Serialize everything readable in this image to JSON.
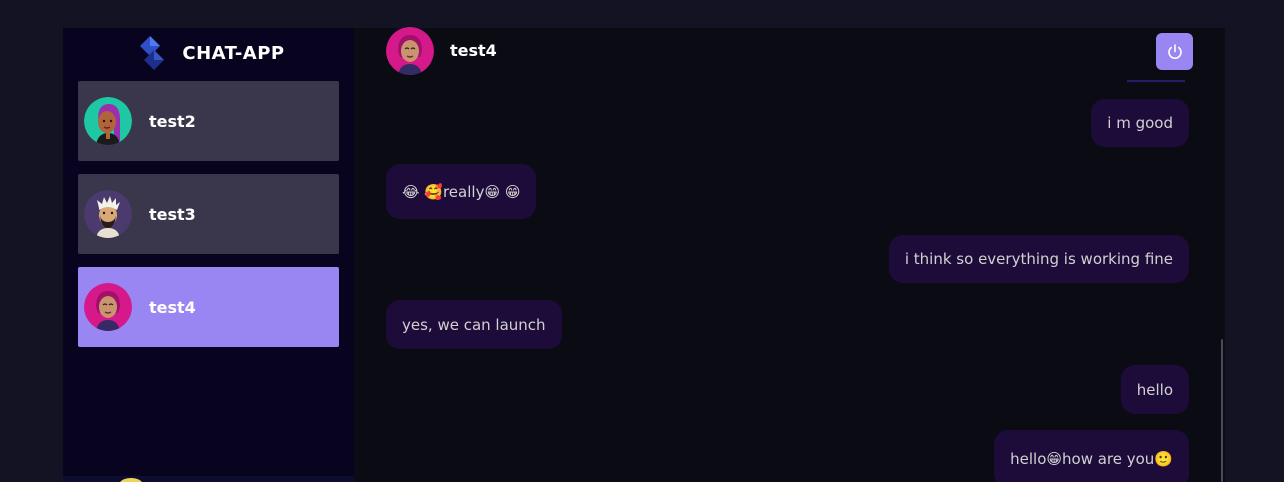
{
  "app": {
    "name": "CHAT-APP"
  },
  "contacts": [
    {
      "name": "test2",
      "avatar": "avatar-teal-woman",
      "selected": false
    },
    {
      "name": "test3",
      "avatar": "avatar-bearded-man",
      "selected": false
    },
    {
      "name": "test4",
      "avatar": "avatar-pink-woman",
      "selected": true
    }
  ],
  "chat": {
    "current_user": "test4",
    "logout_icon": "power-icon",
    "messages": [
      {
        "text": "i m good",
        "direction": "sent"
      },
      {
        "text": "😂 🥰really😁 😁",
        "direction": "received"
      },
      {
        "text": "i think so everything is working fine",
        "direction": "sent"
      },
      {
        "text": "yes, we can launch",
        "direction": "received"
      },
      {
        "text": "hello",
        "direction": "sent"
      },
      {
        "text": "hello😁how are you🙂",
        "direction": "sent"
      }
    ]
  },
  "colors": {
    "page_bg": "#131324",
    "sidebar_bg": "#080420",
    "contact_bg": "#3b3748",
    "accent": "#9a86f3",
    "bubble_bg": "#1d0c3a"
  }
}
